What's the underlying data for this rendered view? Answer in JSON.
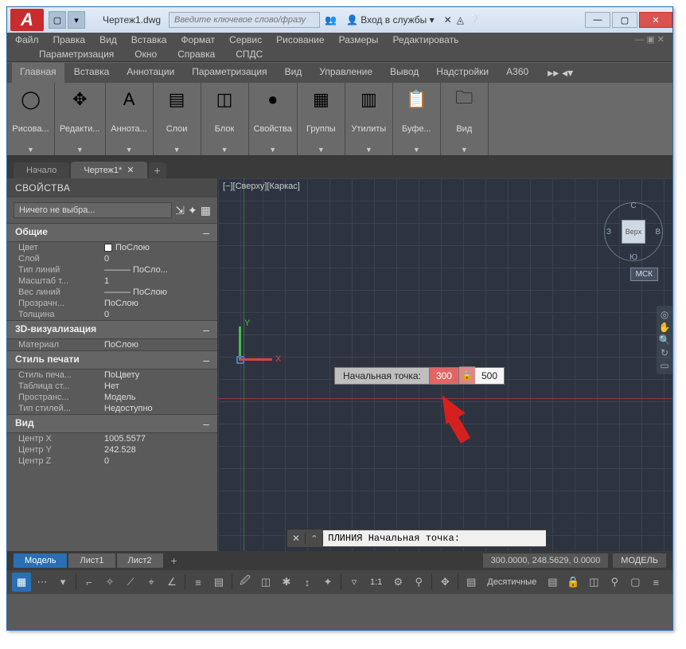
{
  "title": {
    "filename": "Чертеж1.dwg",
    "search_placeholder": "Введите ключевое слово/фразу",
    "login": "Вход в службы"
  },
  "menu1": [
    "Файл",
    "Правка",
    "Вид",
    "Вставка",
    "Формат",
    "Сервис",
    "Рисование",
    "Размеры",
    "Редактировать"
  ],
  "menu2": [
    "Параметризация",
    "Окно",
    "Справка",
    "СПДС"
  ],
  "ribbon_tabs": [
    "Главная",
    "Вставка",
    "Аннотации",
    "Параметризация",
    "Вид",
    "Управление",
    "Вывод",
    "Надстройки",
    "A360"
  ],
  "ribbon_panels": [
    {
      "label": "Рисова...",
      "icon": "◯"
    },
    {
      "label": "Редакти...",
      "icon": "✥"
    },
    {
      "label": "Аннота...",
      "icon": "A"
    },
    {
      "label": "Слои",
      "icon": "▤"
    },
    {
      "label": "Блок",
      "icon": "◫"
    },
    {
      "label": "Свойства",
      "icon": "●"
    },
    {
      "label": "Группы",
      "icon": "▦"
    },
    {
      "label": "Утилиты",
      "icon": "▥"
    },
    {
      "label": "Буфе...",
      "icon": "📋"
    },
    {
      "label": "Вид",
      "icon": "🗀"
    }
  ],
  "dwg_tabs": {
    "start": "Начало",
    "active": "Чертеж1*"
  },
  "props": {
    "title": "СВОЙСТВА",
    "selection": "Ничего не выбра...",
    "cats": {
      "general": {
        "name": "Общие",
        "rows": [
          [
            "Цвет",
            "ПоСлою",
            true
          ],
          [
            "Слой",
            "0",
            false
          ],
          [
            "Тип линий",
            "——— ПоСло...",
            false
          ],
          [
            "Масштаб т...",
            "1",
            false
          ],
          [
            "Вес линий",
            "——— ПоСлою",
            false
          ],
          [
            "Прозрачн...",
            "ПоСлою",
            false
          ],
          [
            "Толщина",
            "0",
            false
          ]
        ]
      },
      "viz3d": {
        "name": "3D-визуализация",
        "rows": [
          [
            "Материал",
            "ПоСлою",
            false
          ]
        ]
      },
      "plot": {
        "name": "Стиль печати",
        "rows": [
          [
            "Стиль печа...",
            "ПоЦвету",
            false
          ],
          [
            "Таблица ст...",
            "Нет",
            false
          ],
          [
            "Пространс...",
            "Модель",
            false
          ],
          [
            "Тип стилей...",
            "Недоступно",
            false
          ]
        ]
      },
      "view": {
        "name": "Вид",
        "rows": [
          [
            "Центр X",
            "1005.5577",
            false
          ],
          [
            "Центр Y",
            "242.528",
            false
          ],
          [
            "Центр Z",
            "0",
            false
          ]
        ]
      }
    }
  },
  "viewport": {
    "label": "[−][Сверху][Каркас]",
    "cube_face": "Верх",
    "cube": {
      "n": "С",
      "s": "Ю",
      "e": "В",
      "w": "З"
    },
    "wcs": "МСК"
  },
  "dyn": {
    "label": "Начальная точка:",
    "v1": "300",
    "v2": "500"
  },
  "cmd": {
    "text": "ПЛИНИЯ Начальная точка:"
  },
  "layout": {
    "model": "Модель",
    "sheets": [
      "Лист1",
      "Лист2"
    ],
    "coords": "300.0000, 248.5629, 0.0000",
    "space": "МОДЕЛЬ"
  },
  "status": {
    "scale": "1:1",
    "units": "Десятичные"
  }
}
